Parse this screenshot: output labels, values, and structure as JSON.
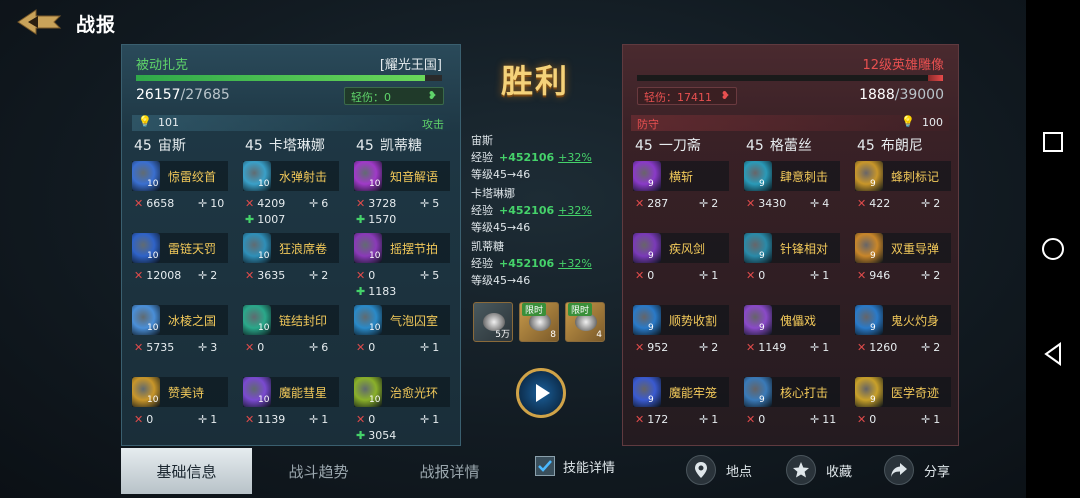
{
  "header": {
    "title": "战报"
  },
  "left": {
    "name": "被动扎克",
    "kingdom": "[耀光王国]",
    "hp": "26157",
    "hp_max": "/27685",
    "hp_fraction": 0.944,
    "injury": "轻伤：0",
    "power": "101",
    "side_label": "攻击",
    "heroes": [
      {
        "level": "45",
        "name": "宙斯",
        "skills": [
          {
            "name": "惊雷绞首",
            "lv": "10",
            "color": "#3a6fd0",
            "kill": "6658",
            "assist": "10",
            "heal": ""
          },
          {
            "name": "雷链天罚",
            "lv": "10",
            "color": "#2f63c8",
            "kill": "12008",
            "assist": "2",
            "heal": ""
          },
          {
            "name": "冰棱之国",
            "lv": "10",
            "color": "#4a8fd8",
            "kill": "5735",
            "assist": "3",
            "heal": ""
          },
          {
            "name": "赞美诗",
            "lv": "10",
            "color": "#c8962a",
            "kill": "0",
            "assist": "1",
            "heal": ""
          }
        ]
      },
      {
        "level": "45",
        "name": "卡塔琳娜",
        "skills": [
          {
            "name": "水弹射击",
            "lv": "10",
            "color": "#3aa0c8",
            "kill": "4209",
            "assist": "6",
            "heal": "1007"
          },
          {
            "name": "狂浪席卷",
            "lv": "10",
            "color": "#2f8fb8",
            "kill": "3635",
            "assist": "2",
            "heal": ""
          },
          {
            "name": "链结封印",
            "lv": "10",
            "color": "#2aa88a",
            "kill": "0",
            "assist": "6",
            "heal": ""
          },
          {
            "name": "魔能彗星",
            "lv": "10",
            "color": "#7a4ad0",
            "kill": "1139",
            "assist": "1",
            "heal": ""
          }
        ]
      },
      {
        "level": "45",
        "name": "凯蒂糖",
        "skills": [
          {
            "name": "知音解语",
            "lv": "10",
            "color": "#a03ac8",
            "kill": "3728",
            "assist": "5",
            "heal": "1570"
          },
          {
            "name": "摇摆节拍",
            "lv": "10",
            "color": "#8a3ab8",
            "kill": "0",
            "assist": "5",
            "heal": "1183"
          },
          {
            "name": "气泡囚室",
            "lv": "10",
            "color": "#2a8ac8",
            "kill": "0",
            "assist": "1",
            "heal": ""
          },
          {
            "name": "治愈光环",
            "lv": "10",
            "color": "#8ab02a",
            "kill": "0",
            "assist": "1",
            "heal": "3054"
          }
        ]
      }
    ]
  },
  "right": {
    "name": "12级英雄雕像",
    "hp": "1888",
    "hp_max": "/39000",
    "hp_fraction": 0.048,
    "injury": "轻伤：17411",
    "power": "100",
    "side_label": "防守",
    "heroes": [
      {
        "level": "45",
        "name": "一刀斋",
        "skills": [
          {
            "name": "横斩",
            "lv": "9",
            "color": "#8a3ac8",
            "kill": "287",
            "assist": "2"
          },
          {
            "name": "疾风剑",
            "lv": "9",
            "color": "#7a3ab8",
            "kill": "0",
            "assist": "1"
          },
          {
            "name": "顺势收割",
            "lv": "9",
            "color": "#2a7ac8",
            "kill": "952",
            "assist": "2"
          },
          {
            "name": "魔能牢笼",
            "lv": "9",
            "color": "#3a5ad0",
            "kill": "172",
            "assist": "1"
          }
        ]
      },
      {
        "level": "45",
        "name": "格蕾丝",
        "skills": [
          {
            "name": "肆意刺击",
            "lv": "9",
            "color": "#2a9ab8",
            "kill": "3430",
            "assist": "4"
          },
          {
            "name": "针锋相对",
            "lv": "9",
            "color": "#2a8aa8",
            "kill": "0",
            "assist": "1"
          },
          {
            "name": "傀儡戏",
            "lv": "9",
            "color": "#8a4ac8",
            "kill": "1149",
            "assist": "1"
          },
          {
            "name": "核心打击",
            "lv": "9",
            "color": "#3a7ab8",
            "kill": "0",
            "assist": "11"
          }
        ]
      },
      {
        "level": "45",
        "name": "布朗尼",
        "skills": [
          {
            "name": "蜂刺标记",
            "lv": "9",
            "color": "#c8962a",
            "kill": "422",
            "assist": "2"
          },
          {
            "name": "双重导弹",
            "lv": "9",
            "color": "#c8862a",
            "kill": "946",
            "assist": "2"
          },
          {
            "name": "鬼火灼身",
            "lv": "9",
            "color": "#2a7ac8",
            "kill": "1260",
            "assist": "2"
          },
          {
            "name": "医学奇迹",
            "lv": "9",
            "color": "#c8a02a",
            "kill": "0",
            "assist": "1"
          }
        ]
      }
    ]
  },
  "center": {
    "result": "胜利",
    "exp": [
      {
        "hero": "宙斯",
        "label": "经验",
        "gain": "+452106",
        "pct": "+32%",
        "level": "等级45→46"
      },
      {
        "hero": "卡塔琳娜",
        "label": "经验",
        "gain": "+452106",
        "pct": "+32%",
        "level": "等级45→46"
      },
      {
        "hero": "凯蒂糖",
        "label": "经验",
        "gain": "+452106",
        "pct": "+32%",
        "level": "等级45→46"
      }
    ],
    "rewards": [
      {
        "tag": "",
        "count": "5万",
        "icon": "iron-ore-icon"
      },
      {
        "tag": "限时",
        "count": "8",
        "icon": "wheel-icon"
      },
      {
        "tag": "限时",
        "count": "4",
        "icon": "horn-icon"
      }
    ]
  },
  "bottom": {
    "tabs": [
      "基础信息",
      "战斗趋势",
      "战报详情"
    ],
    "skill_detail": "技能详情",
    "location": "地点",
    "favorite": "收藏",
    "share": "分享"
  }
}
